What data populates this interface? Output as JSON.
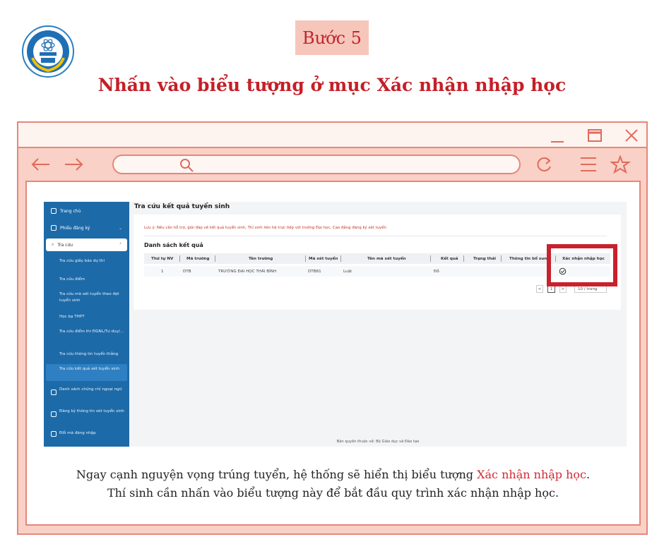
{
  "header": {
    "step_label": "Bước 5",
    "title": "Nhấn vào biểu tượng ở mục Xác nhận nhập học",
    "logo_icon": "university-logo-icon"
  },
  "browser": {
    "window_controls": [
      "minimize-icon",
      "maximize-icon",
      "close-icon"
    ],
    "nav_icons": [
      "back-arrow-icon",
      "forward-arrow-icon",
      "search-icon",
      "reload-icon",
      "menu-icon",
      "star-icon"
    ]
  },
  "portal": {
    "sidebar": {
      "items": [
        {
          "label": "Trang chủ"
        },
        {
          "label": "Phiếu đăng ký"
        },
        {
          "label": "Tra cứu"
        }
      ],
      "sub_items": [
        "Tra cứu giấy báo dự thi",
        "Tra cứu điểm",
        "Tra cứu mã xét tuyển theo đợt tuyển sinh",
        "Học bạ THPT",
        "Tra cứu điểm thi ĐGNL/Tư duy/...",
        "Tra cứu thông tin tuyển thẳng",
        "Tra cứu kết quả xét tuyển sinh"
      ],
      "bottom_items": [
        "Danh sách chứng chỉ ngoại ngữ",
        "Đăng ký thông tin xét tuyển sinh",
        "Đổi mã đăng nhập"
      ]
    },
    "page_title": "Tra cứu kết quả tuyển sinh",
    "note": "Lưu ý: Nếu cần hỗ trợ, giải đáp về kết quả tuyển sinh, Thí sinh liên hệ trực tiếp với trường Đại học, Cao đẳng đăng ký xét tuyển",
    "list_title": "Danh sách kết quả",
    "columns": [
      "Thứ tự NV",
      "Mã trường",
      "Tên trường",
      "Mã xét tuyển",
      "Tên mã xét tuyển",
      "Kết quả",
      "Trạng thái",
      "Thông tin bổ sung",
      "Xác nhận nhập học"
    ],
    "rows": [
      [
        "1",
        "DTB",
        "TRƯỜNG ĐẠI HỌC THÁI BÌNH",
        "DTB81",
        "Luật",
        "Đỗ",
        "",
        "",
        ""
      ]
    ],
    "pagination": {
      "prev": "<",
      "page": "1",
      "next": ">",
      "page_size": "10 / trang"
    },
    "footer": "Bản quyền thuộc về: Bộ Giáo dục và Đào tạo",
    "confirm_icon": "check-circle-icon"
  },
  "caption": {
    "line1_before": "Ngay cạnh nguyện vọng trúng tuyển, hệ thống sẽ hiển thị biểu tượng ",
    "line1_highlight": "Xác nhận nhập học",
    "line1_after": ".",
    "line2": "Thí sinh cần nhấn vào biểu tượng này để bắt đầu quy trình xác nhận nhập học."
  },
  "colors": {
    "accent_red": "#c51f28",
    "frame_pink": "#f9d1c6",
    "frame_border": "#e6867a",
    "sidebar_blue": "#1d6aa8"
  }
}
